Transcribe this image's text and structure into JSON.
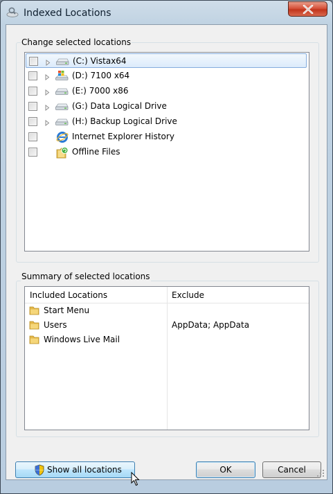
{
  "window": {
    "title": "Indexed Locations"
  },
  "change_group": {
    "label": "Change selected locations",
    "items": [
      {
        "label": "(C:) Vistax64",
        "checked": false,
        "expandable": true,
        "icon": "drive-icon",
        "selected": true
      },
      {
        "label": "(D:) 7100 x64",
        "checked": false,
        "expandable": true,
        "icon": "windows-drive-icon",
        "selected": false
      },
      {
        "label": "(E:) 7000 x86",
        "checked": false,
        "expandable": true,
        "icon": "drive-icon",
        "selected": false
      },
      {
        "label": "(G:) Data Logical Drive",
        "checked": false,
        "expandable": true,
        "icon": "drive-icon",
        "selected": false
      },
      {
        "label": "(H:) Backup Logical Drive",
        "checked": false,
        "expandable": true,
        "icon": "drive-icon",
        "selected": false
      },
      {
        "label": "Internet Explorer History",
        "checked": false,
        "expandable": false,
        "icon": "internet-explorer-icon",
        "selected": false
      },
      {
        "label": "Offline Files",
        "checked": false,
        "expandable": false,
        "icon": "offline-files-icon",
        "selected": false
      }
    ]
  },
  "summary_group": {
    "label": "Summary of selected locations",
    "columns": {
      "included": "Included Locations",
      "exclude": "Exclude"
    },
    "rows": [
      {
        "included": "Start Menu",
        "exclude": ""
      },
      {
        "included": "Users",
        "exclude": "AppData; AppData"
      },
      {
        "included": "Windows Live Mail",
        "exclude": ""
      }
    ]
  },
  "buttons": {
    "show_all": "Show all locations",
    "ok": "OK",
    "cancel": "Cancel"
  },
  "colors": {
    "selection_border": "#84acdd",
    "close_button": "#c2351c",
    "hot_button": "#bee6fd"
  }
}
